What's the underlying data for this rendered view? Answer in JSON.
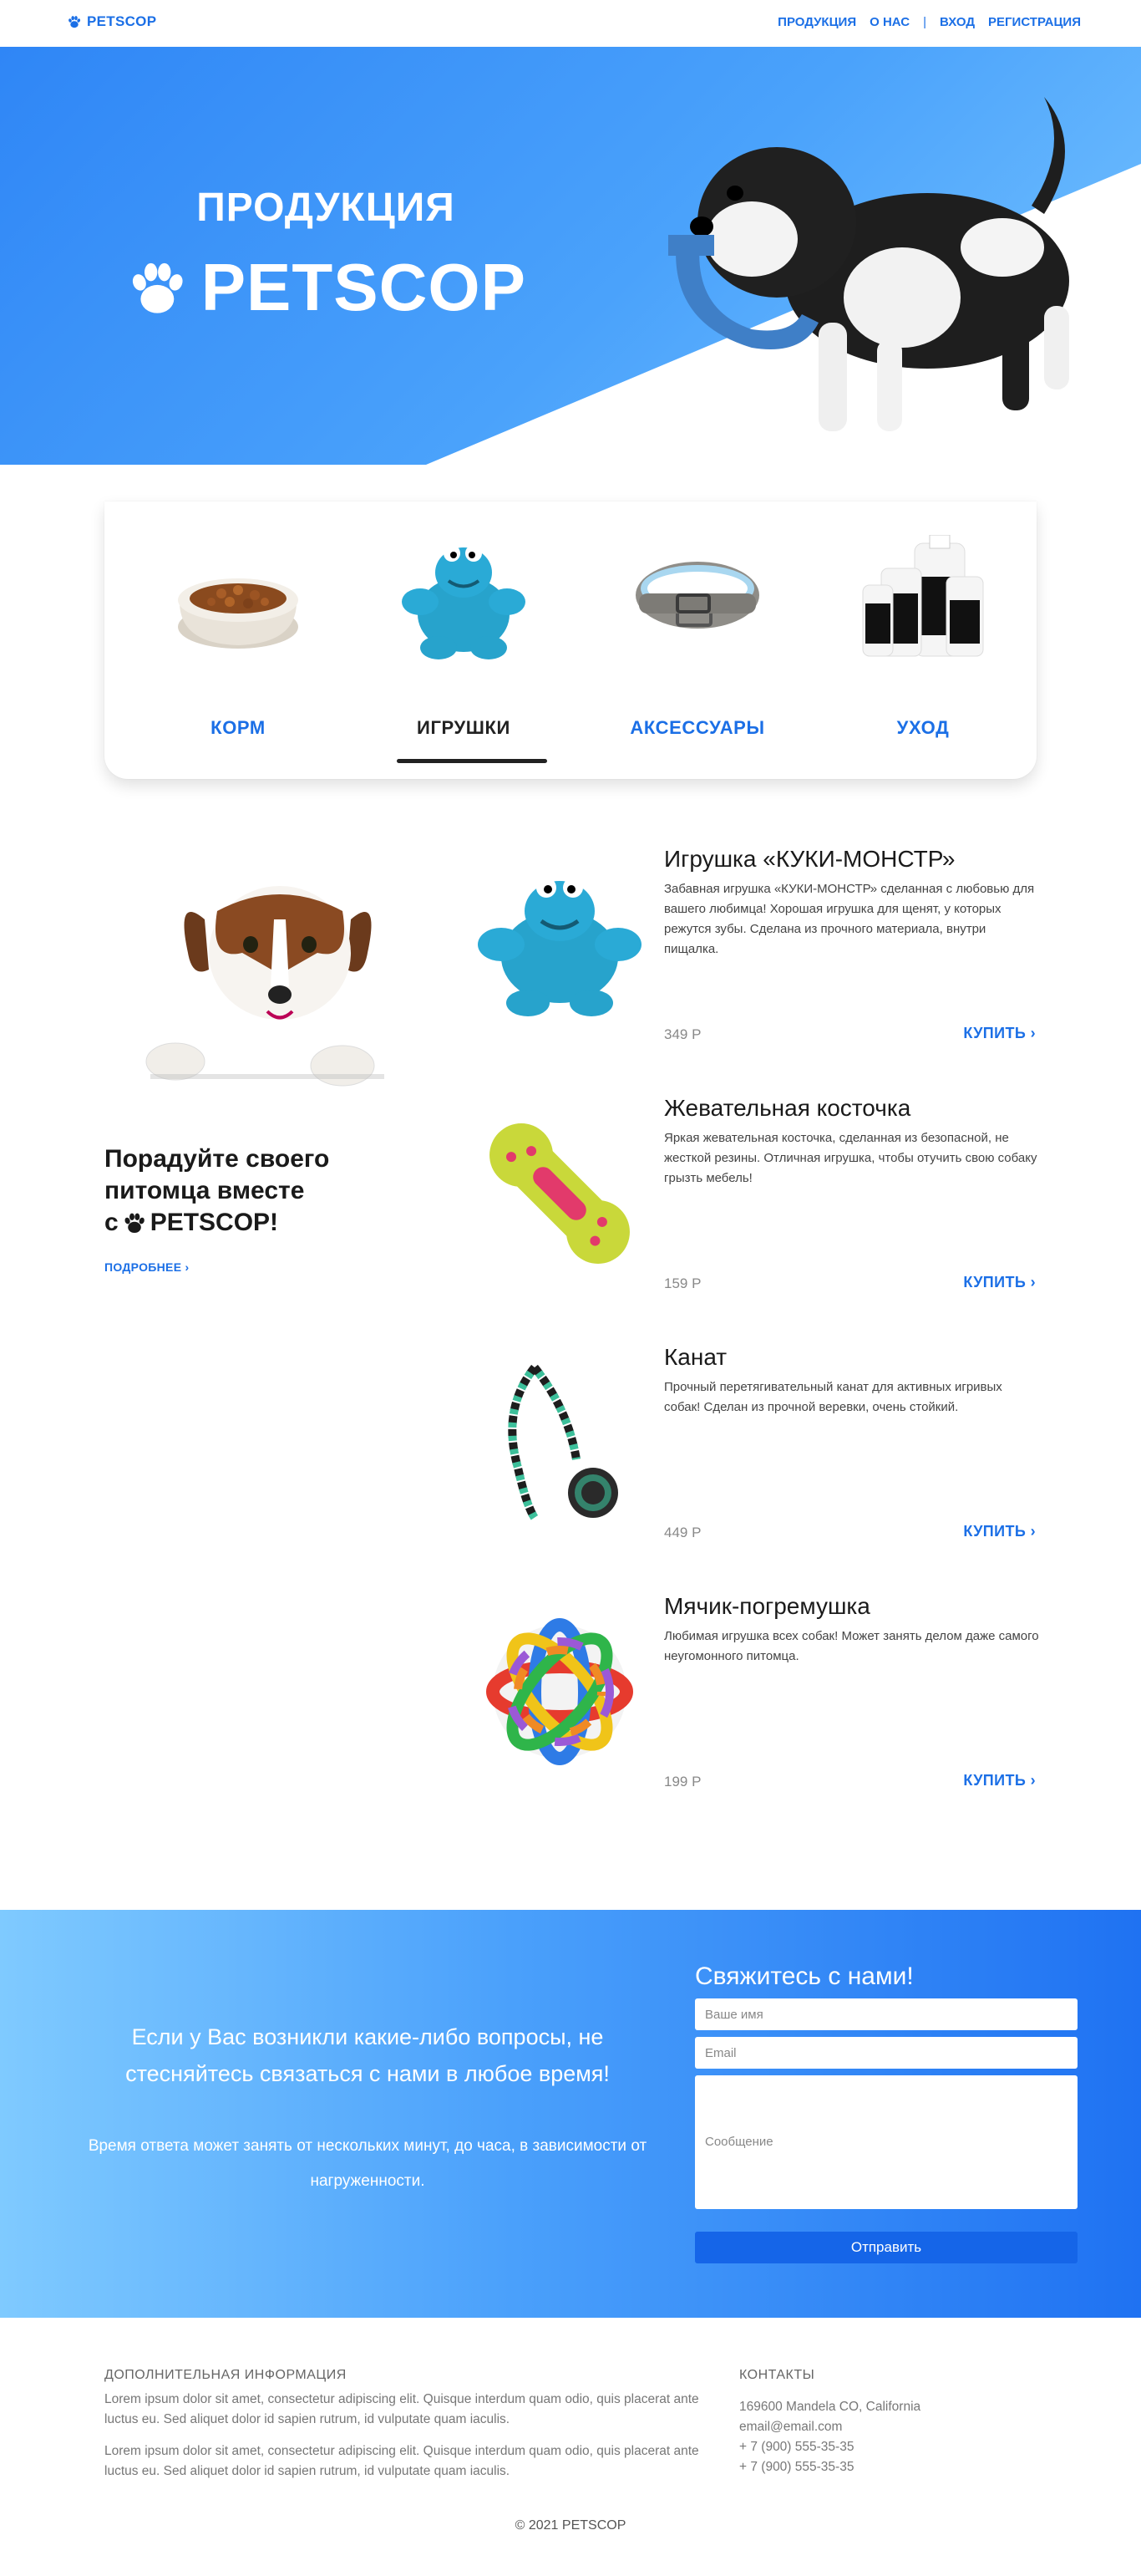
{
  "navbar": {
    "logo_text": "PETSCOP",
    "links": [
      "ПРОДУКЦИЯ",
      "О НАС",
      "|",
      "ВХОД",
      "РЕГИСТРАЦИЯ"
    ]
  },
  "hero": {
    "line1": "ПРОДУКЦИЯ",
    "line2": "PETSCOP"
  },
  "categories": [
    {
      "label": "КОРМ",
      "active": false
    },
    {
      "label": "ИГРУШКИ",
      "active": true
    },
    {
      "label": "АКСЕССУАРЫ",
      "active": false
    },
    {
      "label": "УХОД",
      "active": false
    }
  ],
  "promo": {
    "title_line1": "Порадуйте своего",
    "title_line2": "питомца вместе",
    "title_prefix": "с",
    "title_brand": "PETSCOP!",
    "more_link": "ПОДРОБНЕЕ ›"
  },
  "products": [
    {
      "name": "Игрушка «КУКИ-МОНСТР»",
      "description": "Забавная игрушка «КУКИ-МОНСТР» сделанная с любовью для вашего любимца! Хорошая игрушка для щенят, у которых режутся зубы. Сделана из прочного материала, внутри пищалка.",
      "price": "349 Р",
      "buy": "КУПИТЬ ›"
    },
    {
      "name": "Жевательная косточка",
      "description": "Яркая жевательная косточка, сделанная из безопасной, не жесткой резины. Отличная игрушка, чтобы отучить свою собаку грызть мебель!",
      "price": "159 Р",
      "buy": "КУПИТЬ ›"
    },
    {
      "name": "Канат",
      "description": "Прочный перетягивательный канат для активных игривых собак! Сделан из прочной веревки, очень стойкий.",
      "price": "449 Р",
      "buy": "КУПИТЬ ›"
    },
    {
      "name": "Мячик-погремушка",
      "description": "Любимая игрушка всех собак! Может занять делом даже самого неугомонного питомца.",
      "price": "199 Р",
      "buy": "КУПИТЬ ›"
    }
  ],
  "contact": {
    "message": "Если у Вас возникли какие-либо вопросы, не стесняйтесь связаться с нами в любое время!",
    "response_note": "Время ответа может занять от нескольких минут, до часа, в зависимости от нагруженности.",
    "form_title": "Свяжитесь с нами!",
    "name_placeholder": "Ваше имя",
    "email_placeholder": "Email",
    "message_placeholder": "Сообщение",
    "submit_label": "Отправить"
  },
  "footer": {
    "info_heading": "ДОПОЛНИТЕЛЬНАЯ ИНФОРМАЦИЯ",
    "paragraph1": "Lorem ipsum dolor sit amet, consectetur adipiscing elit. Quisque interdum quam odio, quis placerat ante luctus eu. Sed aliquet dolor id sapien rutrum, id vulputate quam iaculis.",
    "paragraph2": "Lorem ipsum dolor sit amet, consectetur adipiscing elit. Quisque interdum quam odio, quis placerat ante luctus eu. Sed aliquet dolor id sapien rutrum, id vulputate quam iaculis.",
    "contacts_heading": "КОНТАКТЫ",
    "address": "169600 Mandela CO, California",
    "email": "email@email.com",
    "phone1": "+ 7 (900) 555-35-35",
    "phone2": "+ 7 (900) 555-35-35",
    "copyright": "© 2021 PETSCOP"
  },
  "colors": {
    "accent": "#1b6fe6",
    "hero_blue": "#2f86f6",
    "button_blue": "#1565e8"
  }
}
